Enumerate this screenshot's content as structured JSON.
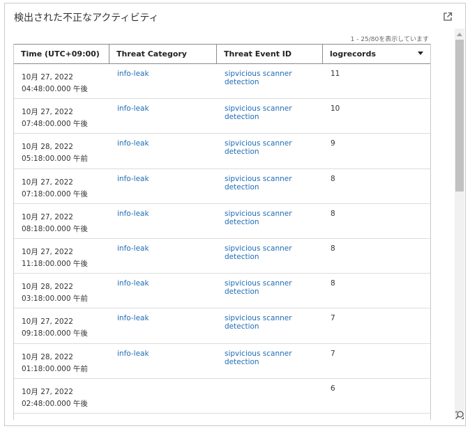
{
  "panel": {
    "title": "検出された不正なアクティビティ",
    "paging_text": "1 - 25/80を表示しています"
  },
  "table": {
    "columns": [
      "Time (UTC+09:00)",
      "Threat Category",
      "Threat Event ID",
      "logrecords"
    ],
    "rows": [
      {
        "date": "10月 27, 2022",
        "time": "04:48:00.000 午後",
        "category": "info-leak",
        "event_line1": "sipvicious scanner",
        "event_line2": "detection",
        "logrecords": "11"
      },
      {
        "date": "10月 27, 2022",
        "time": "07:48:00.000 午後",
        "category": "info-leak",
        "event_line1": "sipvicious scanner",
        "event_line2": "detection",
        "logrecords": "10"
      },
      {
        "date": "10月 28, 2022",
        "time": "05:18:00.000 午前",
        "category": "info-leak",
        "event_line1": "sipvicious scanner",
        "event_line2": "detection",
        "logrecords": "9"
      },
      {
        "date": "10月 27, 2022",
        "time": "07:18:00.000 午後",
        "category": "info-leak",
        "event_line1": "sipvicious scanner",
        "event_line2": "detection",
        "logrecords": "8"
      },
      {
        "date": "10月 27, 2022",
        "time": "08:18:00.000 午後",
        "category": "info-leak",
        "event_line1": "sipvicious scanner",
        "event_line2": "detection",
        "logrecords": "8"
      },
      {
        "date": "10月 27, 2022",
        "time": "11:18:00.000 午後",
        "category": "info-leak",
        "event_line1": "sipvicious scanner",
        "event_line2": "detection",
        "logrecords": "8"
      },
      {
        "date": "10月 28, 2022",
        "time": "03:18:00.000 午前",
        "category": "info-leak",
        "event_line1": "sipvicious scanner",
        "event_line2": "detection",
        "logrecords": "8"
      },
      {
        "date": "10月 27, 2022",
        "time": "09:18:00.000 午後",
        "category": "info-leak",
        "event_line1": "sipvicious scanner",
        "event_line2": "detection",
        "logrecords": "7"
      },
      {
        "date": "10月 28, 2022",
        "time": "01:18:00.000 午前",
        "category": "info-leak",
        "event_line1": "sipvicious scanner",
        "event_line2": "detection",
        "logrecords": "7"
      },
      {
        "date": "10月 27, 2022",
        "time": "02:48:00.000 午後",
        "category": "",
        "event_line1": "",
        "event_line2": "",
        "logrecords": "6"
      }
    ]
  },
  "icons": {
    "open": "external-link-icon",
    "sort": "sort-desc-icon",
    "zoom": "zoom-reset-icon"
  },
  "colors": {
    "link": "#1f6cb5",
    "border": "#c9c9c9",
    "scroll_thumb": "#c1c1c1"
  }
}
